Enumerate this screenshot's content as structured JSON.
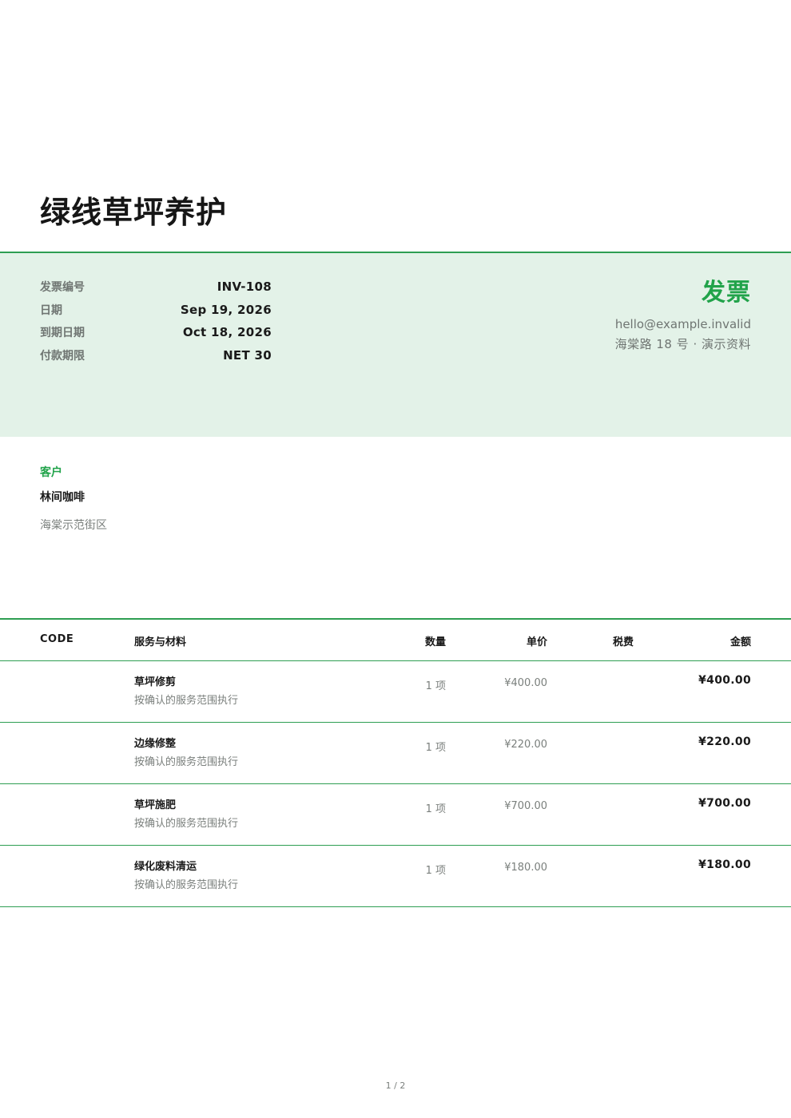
{
  "company": {
    "name": "绿线草坪养护"
  },
  "invoice": {
    "title": "发票",
    "meta": [
      {
        "label": "发票编号",
        "value": "INV-108"
      },
      {
        "label": "日期",
        "value": "Sep 19, 2026"
      },
      {
        "label": "到期日期",
        "value": "Oct 18, 2026"
      },
      {
        "label": "付款期限",
        "value": "NET 30"
      }
    ]
  },
  "sender": {
    "email": "hello@example.invalid",
    "address": "海棠路 18 号 · 演示资料"
  },
  "client": {
    "label": "客户",
    "name": "林间咖啡",
    "address": "海棠示范街区"
  },
  "table": {
    "headers": {
      "code": "CODE",
      "description": "服务与材料",
      "quantity": "数量",
      "unit_price": "单价",
      "tax": "税费",
      "amount": "金额"
    },
    "items": [
      {
        "name": "草坪修剪",
        "note": "按确认的服务范围执行",
        "quantity": "1 项",
        "unit_price": "¥400.00",
        "amount": "¥400.00"
      },
      {
        "name": "边缘修整",
        "note": "按确认的服务范围执行",
        "quantity": "1 项",
        "unit_price": "¥220.00",
        "amount": "¥220.00"
      },
      {
        "name": "草坪施肥",
        "note": "按确认的服务范围执行",
        "quantity": "1 项",
        "unit_price": "¥700.00",
        "amount": "¥700.00"
      },
      {
        "name": "绿化废料清运",
        "note": "按确认的服务范围执行",
        "quantity": "1 项",
        "unit_price": "¥180.00",
        "amount": "¥180.00"
      }
    ]
  },
  "footer": {
    "page": "1 / 2"
  },
  "colors": {
    "accent": "#21a34a",
    "band": "#e3f2e8",
    "rule": "#2e9e52"
  }
}
